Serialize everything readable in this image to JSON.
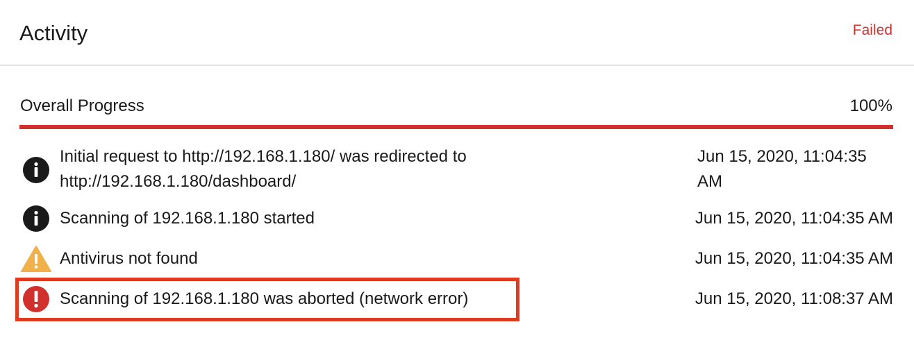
{
  "header": {
    "title": "Activity",
    "status": "Failed"
  },
  "progress": {
    "label": "Overall Progress",
    "value_text": "100%",
    "fraction": 1.0
  },
  "colors": {
    "error": "#d0312d",
    "info": "#1a1a1a",
    "warning": "#f0b14b",
    "highlight": "#e23a1e"
  },
  "events": [
    {
      "icon": "info-icon",
      "message": "Initial request to http://192.168.1.180/ was redirected to http://192.168.1.180/dashboard/",
      "time": "Jun 15, 2020, 11:04:35 AM"
    },
    {
      "icon": "info-icon",
      "message": "Scanning of 192.168.1.180 started",
      "time": "Jun 15, 2020, 11:04:35 AM"
    },
    {
      "icon": "warning-icon",
      "message": "Antivirus not found",
      "time": "Jun 15, 2020, 11:04:35 AM"
    },
    {
      "icon": "error-icon",
      "message": "Scanning of 192.168.1.180 was aborted (network error)",
      "time": "Jun 15, 2020, 11:08:37 AM"
    }
  ]
}
